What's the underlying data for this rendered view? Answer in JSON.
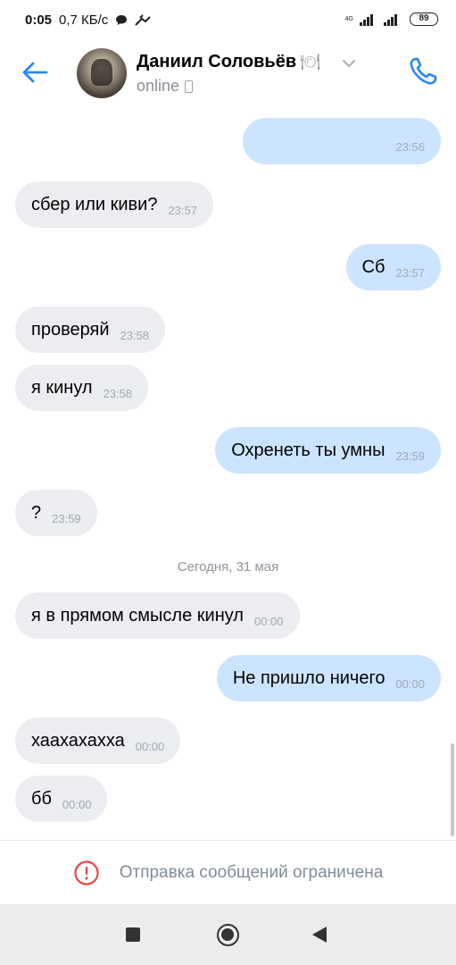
{
  "status_bar": {
    "time": "0:05",
    "speed": "0,7 КБ/с",
    "network": "4G",
    "battery": "89"
  },
  "header": {
    "contact_name": "Даниил Соловьёв",
    "status": "online",
    "icons": {
      "back": "back-arrow-icon",
      "call": "phone-icon",
      "menu": "chevron-down-icon",
      "badge": "plate-icon",
      "device": "mobile-device-icon"
    }
  },
  "messages": [
    {
      "direction": "out",
      "text": "",
      "time": "23:56"
    },
    {
      "direction": "in",
      "text": "сбер или киви?",
      "time": "23:57"
    },
    {
      "direction": "out",
      "text": "Сб",
      "time": "23:57"
    },
    {
      "direction": "in",
      "text": "проверяй",
      "time": "23:58"
    },
    {
      "direction": "in",
      "text": "я кинул",
      "time": "23:58"
    },
    {
      "direction": "out",
      "text": "Охренеть ты умны",
      "time": "23:59"
    },
    {
      "direction": "in",
      "text": "?",
      "time": "23:59"
    },
    {
      "direction": "in",
      "text": "я в прямом смысле кинул",
      "time": "00:00"
    },
    {
      "direction": "out",
      "text": "Не пришло ничего",
      "time": "00:00"
    },
    {
      "direction": "in",
      "text": "хаахахахха",
      "time": "00:00"
    },
    {
      "direction": "in",
      "text": "бб",
      "time": "00:00"
    }
  ],
  "date_separator": "Сегодня, 31 мая",
  "restriction": {
    "text": "Отправка сообщений ограничена",
    "icon": "warning-circle-icon",
    "color": "#e64646"
  },
  "colors": {
    "accent": "#2787f5",
    "incoming_bubble": "#ebedf0",
    "outgoing_bubble": "#cce4ff"
  }
}
